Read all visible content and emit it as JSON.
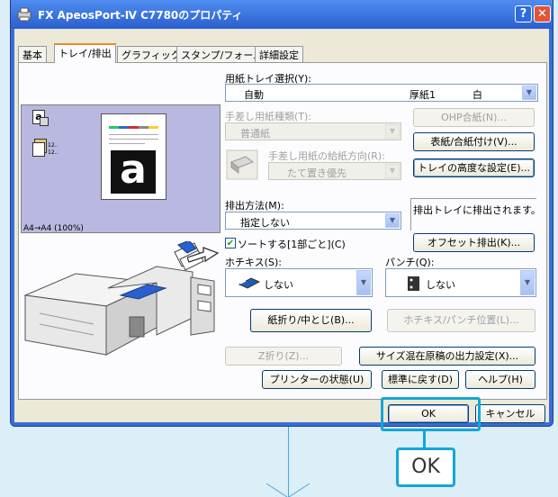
{
  "window": {
    "title": "FX ApeosPort-Ⅳ C7780のプロパティ",
    "help_label": "?",
    "close_label": "✕"
  },
  "tabs": [
    "基本",
    "トレイ/排出",
    "グラフィックス",
    "スタンプ/フォーム",
    "詳細設定"
  ],
  "preview": {
    "caption": "A4→A4 (100%)",
    "paper_letter": "a",
    "mini_letter": "a",
    "stack_label_1": "12..",
    "stack_label_2": "12.."
  },
  "tray": {
    "label": "用紙トレイ選択(Y):",
    "value_main": "自動",
    "value_paper": "厚紙1",
    "value_color": "白"
  },
  "manual_type": {
    "label": "手差し用紙種類(T):",
    "value": "普通紙"
  },
  "manual_orient": {
    "label": "手差し用紙の給紙方向(R):",
    "value": "たて置き優先"
  },
  "buttons": {
    "ohp": "OHP合紙(N)...",
    "cover": "表紙/合紙付け(V)...",
    "tray_advanced": "トレイの高度な設定(E)...",
    "offset": "オフセット排出(K)...",
    "fold": "紙折り/中とじ(B)...",
    "staple_pos": "ホチキス/パンチ位置(L)...",
    "zfold": "Z折り(Z)...",
    "mixed_size": "サイズ混在原稿の出力設定(X)...",
    "printer_status": "プリンターの状態(U)",
    "reset_default": "標準に戻す(D)",
    "help": "ヘルプ(H)",
    "ok": "OK",
    "cancel": "キャンセル"
  },
  "output": {
    "label": "排出方法(M):",
    "value": "指定しない",
    "info": "排出トレイに排出されます。"
  },
  "sort": {
    "label": "ソートする[1部ごと](C)",
    "checked": true
  },
  "staple": {
    "label": "ホチキス(S):",
    "value": "しない"
  },
  "punch": {
    "label": "パンチ(Q):",
    "value": "しない"
  },
  "callout": {
    "label": "OK"
  },
  "colors": {
    "accent": "#12a7d6",
    "title_bar": "#2a5fd0"
  }
}
